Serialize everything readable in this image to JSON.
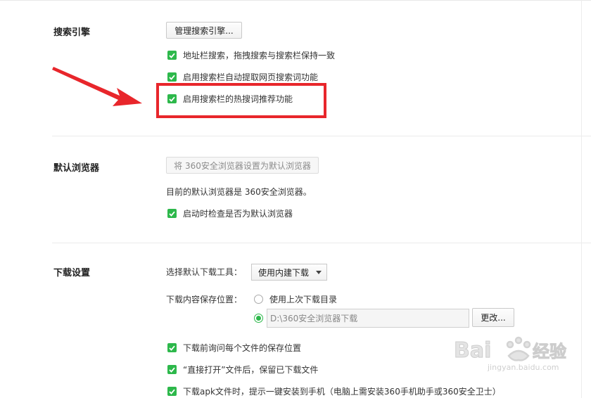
{
  "sections": {
    "search": {
      "title": "搜索引擎",
      "manage_button": "管理搜索引擎...",
      "options": [
        "地址栏搜索，拖拽搜索与搜索栏保持一致",
        "启用搜索栏自动提取网页搜索词功能",
        "启用搜索栏的热搜词推荐功能"
      ]
    },
    "default_browser": {
      "title": "默认浏览器",
      "set_default_button": "将 360安全浏览器设置为默认浏览器",
      "status_text": "目前的默认浏览器是 360安全浏览器。",
      "check_option": "启动时检查是否为默认浏览器"
    },
    "download": {
      "title": "下载设置",
      "tool_label": "选择默认下载工具：",
      "tool_selected": "使用内建下载",
      "location_label": "下载内容保存位置：",
      "radio_last_dir": "使用上次下载目录",
      "path_value": "D:\\360安全浏览器下载",
      "change_button": "更改...",
      "options": [
        "下载前询问每个文件的保存位置",
        "“直接打开”文件后，保留已下载文件",
        "下载apk文件时，提示一键安装到手机（电脑上需安装360手机助手或360安全卫士）"
      ]
    }
  },
  "watermark": {
    "brand_text": "Bai  经验",
    "url_text": "jingyan.baidu.com"
  },
  "colors": {
    "check_green": "#2db84b",
    "highlight_red": "#e8262b"
  }
}
